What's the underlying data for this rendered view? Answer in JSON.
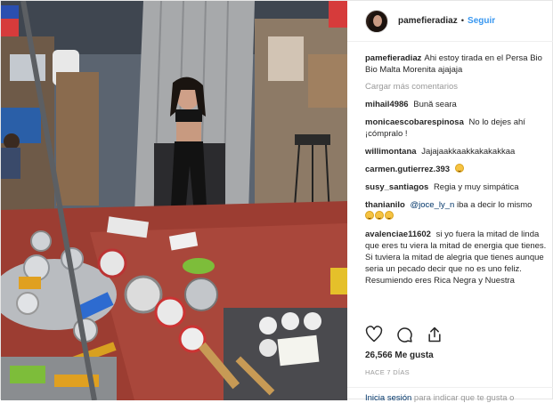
{
  "post": {
    "username": "pamefieradiaz",
    "separator": "•",
    "follow_label": "Seguir",
    "caption": {
      "username": "pamefieradiaz",
      "text": "Ahi estoy tirada en el Persa Bio Bio Malta Morenita ajajaja"
    },
    "load_more_label": "Cargar más comentarios",
    "comments": [
      {
        "username": "mihail4986",
        "text": "Bună seara"
      },
      {
        "username": "monicaescobarespinosa",
        "text": "No lo dejes ahí ¡cómpralo !"
      },
      {
        "username": "willimontana",
        "text": "Jajajaakkaakkakakakkaa"
      },
      {
        "username": "carmen.gutierrez.393",
        "text": "",
        "emoji": "grinning-face-with-sweat"
      },
      {
        "username": "susy_santiagos",
        "text": "Regia y muy simpática"
      },
      {
        "username": "thanianilo",
        "mention": "@joce_ly_n",
        "text": "iba a decir lo mismo",
        "emoji": "grinning-face-x3"
      },
      {
        "username": "avalenciae11602",
        "text": "si yo fuera la mitad de linda que eres tu viera la mitad de energia que tienes. Si tuviera la mitad de alegria que tienes aunque seria un pecado decir que no es uno feliz. Resumiendo eres Rica Negra y Nuestra"
      }
    ],
    "likes": "26,566 Me gusta",
    "date": "HACE 7 DÍAS",
    "footer": {
      "login_label": "Inicia sesión",
      "rest": "para indicar que te gusta o"
    },
    "icons": [
      "heart-icon",
      "comment-icon",
      "share-icon"
    ]
  }
}
